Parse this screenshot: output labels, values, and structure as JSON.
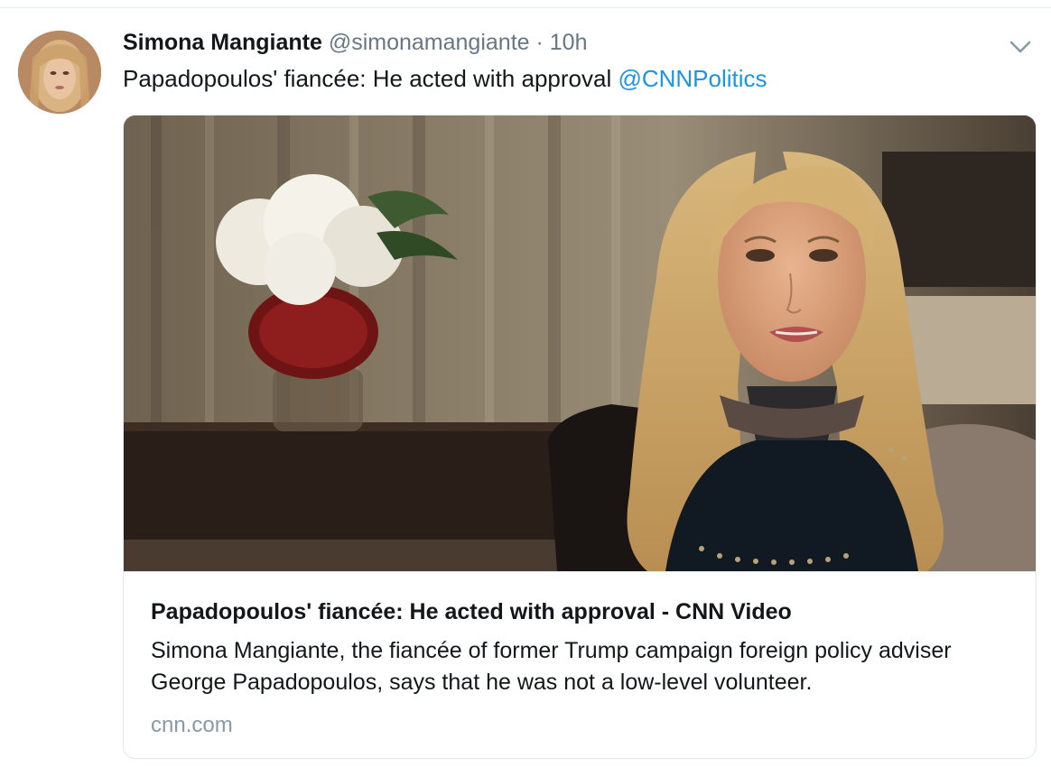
{
  "tweet": {
    "author": {
      "display_name": "Simona Mangiante",
      "handle": "@simonamangiante",
      "separator": "·",
      "time": "10h"
    },
    "text": "Papadopoulos' fiancée: He acted with approval ",
    "mention": "@CNNPolitics",
    "card": {
      "title": "Papadopoulos' fiancée: He acted with approval - CNN Video",
      "description": "Simona Mangiante, the fiancée of former Trump campaign foreign policy adviser George Papadopoulos, says that he was not a low-level volunteer.",
      "domain": "cnn.com"
    }
  },
  "colors": {
    "link": "#1b95e0",
    "secondary_text": "#657786",
    "primary_text": "#14171a",
    "border": "#e1e8ed"
  },
  "icons": {
    "menu": "chevron-down-icon"
  }
}
